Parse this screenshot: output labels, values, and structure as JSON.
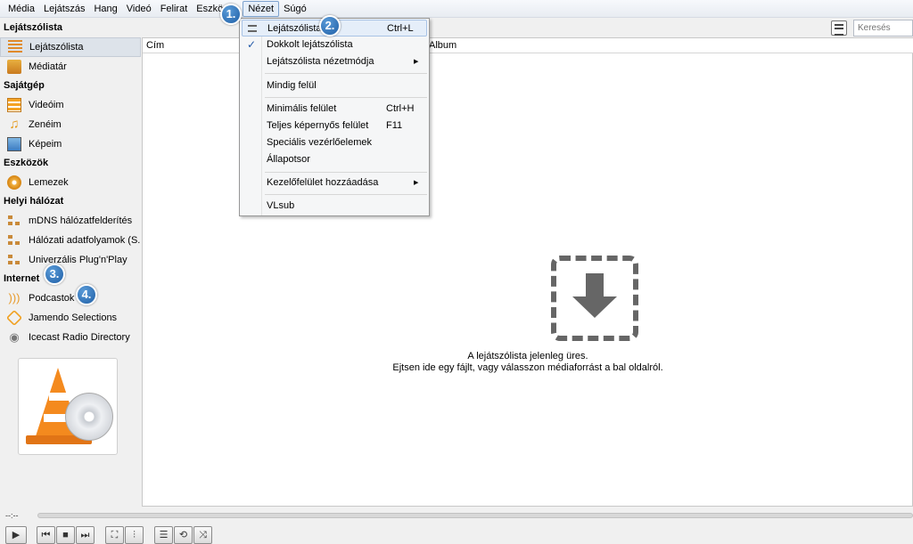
{
  "menubar": {
    "items": [
      "Média",
      "Lejátszás",
      "Hang",
      "Videó",
      "Felirat",
      "Eszközök",
      "Nézet",
      "Súgó"
    ],
    "active_index": 6
  },
  "search": {
    "placeholder": "Keresés"
  },
  "sidebar": {
    "sections": [
      {
        "title": "Lejátszólista",
        "items": [
          {
            "label": "Lejátszólista",
            "icon": "playlist-icon",
            "selected": true
          },
          {
            "label": "Médiatár",
            "icon": "media-library-icon"
          }
        ]
      },
      {
        "title": "Sajátgép",
        "items": [
          {
            "label": "Videóim",
            "icon": "film-icon"
          },
          {
            "label": "Zenéim",
            "icon": "music-note-icon"
          },
          {
            "label": "Képeim",
            "icon": "picture-icon"
          }
        ]
      },
      {
        "title": "Eszközök",
        "items": [
          {
            "label": "Lemezek",
            "icon": "disc-icon"
          }
        ]
      },
      {
        "title": "Helyi hálózat",
        "items": [
          {
            "label": "mDNS hálózatfelderítés",
            "icon": "network-icon"
          },
          {
            "label": "Hálózati adatfolyamok (S...",
            "icon": "network-icon"
          },
          {
            "label": "Univerzális Plug'n'Play",
            "icon": "network-icon"
          }
        ]
      },
      {
        "title": "Internet",
        "items": [
          {
            "label": "Podcastok",
            "icon": "podcast-icon"
          },
          {
            "label": "Jamendo Selections",
            "icon": "jamendo-icon"
          },
          {
            "label": "Icecast Radio Directory",
            "icon": "radio-icon"
          }
        ]
      }
    ]
  },
  "playlist": {
    "columns": [
      "Cím",
      "Album"
    ],
    "empty_line1": "A lejátszólista jelenleg üres.",
    "empty_line2": "Ejtsen ide egy fájlt, vagy válasszon médiaforrást a bal oldalról."
  },
  "view_menu": {
    "items": [
      {
        "label": "Lejátszólista",
        "shortcut": "Ctrl+L",
        "highlighted": true,
        "icon": "playlist-icon"
      },
      {
        "label": "Dokkolt lejátszólista",
        "checked": true
      },
      {
        "label": "Lejátszólista nézetmódja",
        "submenu": true
      },
      {
        "label": "Mindig felül"
      },
      {
        "label": "Minimális felület",
        "shortcut": "Ctrl+H"
      },
      {
        "label": "Teljes képernyős felület",
        "shortcut": "F11"
      },
      {
        "label": "Speciális vezérlőelemek"
      },
      {
        "label": "Állapotsor"
      },
      {
        "label": "Kezelőfelület hozzáadása",
        "submenu": true
      },
      {
        "label": "VLsub"
      }
    ]
  },
  "callouts": [
    "1.",
    "2.",
    "3.",
    "4."
  ],
  "controls": {
    "time": "--:--",
    "buttons": [
      "play",
      "previous",
      "stop",
      "next",
      "fullscreen",
      "extended-settings",
      "playlist",
      "loop",
      "shuffle"
    ]
  },
  "colors": {
    "accent": "#1f5fa6",
    "vlc_orange": "#f48a1e",
    "menu_highlight": "#e5eef9"
  }
}
